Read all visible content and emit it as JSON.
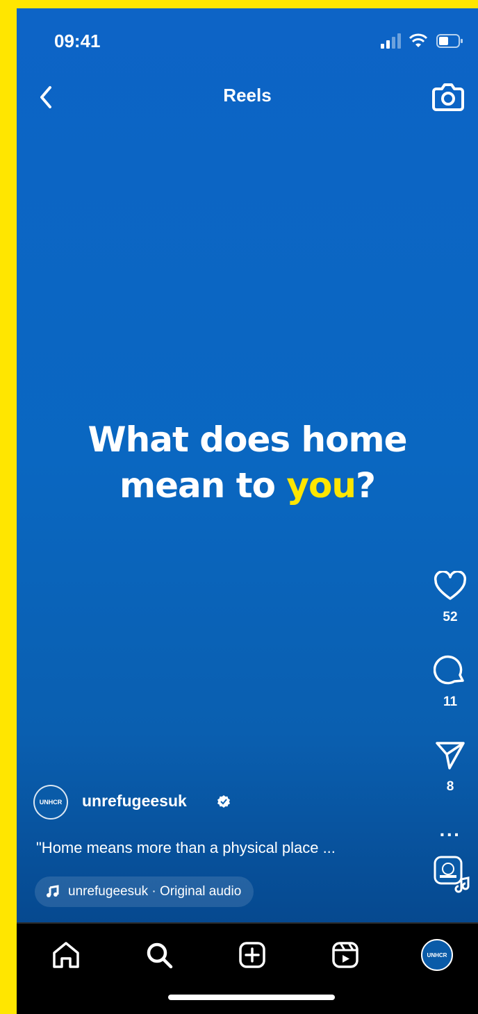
{
  "status_bar": {
    "time": "09:41"
  },
  "header": {
    "title": "Reels"
  },
  "reel": {
    "headline_part1": "What does home",
    "headline_part2": "mean to ",
    "headline_highlight": "you",
    "headline_end": "?",
    "likes": "52",
    "comments": "11",
    "shares": "8",
    "author": "unrefugeesuk",
    "author_verified": true,
    "avatar_text": "UNHCR",
    "caption": "\"Home means more than a physical place ...",
    "audio": "unrefugeesuk · Original audio"
  },
  "bottom_nav": {
    "items": [
      "home-icon",
      "search-icon",
      "create-icon",
      "reels-icon",
      "profile-avatar"
    ],
    "avatar_text": "UNHCR"
  },
  "colors": {
    "frame": "#ffe600",
    "background": "#0b63c0",
    "highlight": "#ffe600"
  }
}
